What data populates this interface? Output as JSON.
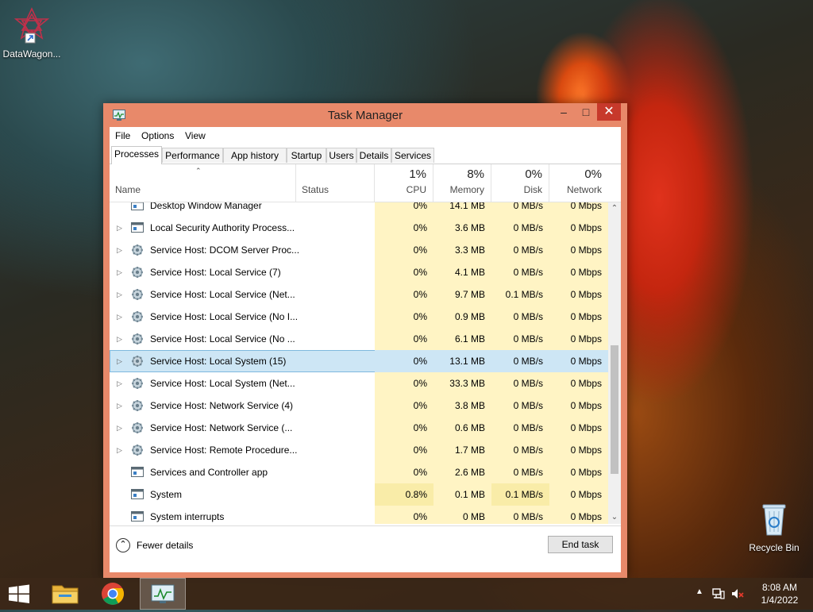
{
  "desktop": {
    "icons": [
      {
        "label": "DataWagon..."
      },
      {
        "label": "Recycle Bin"
      }
    ]
  },
  "window": {
    "title": "Task Manager",
    "controls": {
      "minimize": "‒",
      "maximize": "□",
      "close": "✕"
    }
  },
  "menu": [
    "File",
    "Options",
    "View"
  ],
  "tabs": [
    "Processes",
    "Performance",
    "App history",
    "Startup",
    "Users",
    "Details",
    "Services"
  ],
  "columns": {
    "name": "Name",
    "status": "Status",
    "cpu": {
      "pct": "1%",
      "label": "CPU"
    },
    "memory": {
      "pct": "8%",
      "label": "Memory"
    },
    "disk": {
      "pct": "0%",
      "label": "Disk"
    },
    "network": {
      "pct": "0%",
      "label": "Network"
    }
  },
  "processes": [
    {
      "name": "Desktop Window Manager",
      "expandable": false,
      "icon": "window-icon",
      "cpu": "0%",
      "memory": "14.1 MB",
      "disk": "0 MB/s",
      "network": "0 Mbps"
    },
    {
      "name": "Local Security Authority Process...",
      "expandable": true,
      "icon": "window-icon",
      "cpu": "0%",
      "memory": "3.6 MB",
      "disk": "0 MB/s",
      "network": "0 Mbps"
    },
    {
      "name": "Service Host: DCOM Server Proc...",
      "expandable": true,
      "icon": "gear-icon",
      "cpu": "0%",
      "memory": "3.3 MB",
      "disk": "0 MB/s",
      "network": "0 Mbps"
    },
    {
      "name": "Service Host: Local Service (7)",
      "expandable": true,
      "icon": "gear-icon",
      "cpu": "0%",
      "memory": "4.1 MB",
      "disk": "0 MB/s",
      "network": "0 Mbps"
    },
    {
      "name": "Service Host: Local Service (Net...",
      "expandable": true,
      "icon": "gear-icon",
      "cpu": "0%",
      "memory": "9.7 MB",
      "disk": "0.1 MB/s",
      "network": "0 Mbps"
    },
    {
      "name": "Service Host: Local Service (No I...",
      "expandable": true,
      "icon": "gear-icon",
      "cpu": "0%",
      "memory": "0.9 MB",
      "disk": "0 MB/s",
      "network": "0 Mbps"
    },
    {
      "name": "Service Host: Local Service (No ...",
      "expandable": true,
      "icon": "gear-icon",
      "cpu": "0%",
      "memory": "6.1 MB",
      "disk": "0 MB/s",
      "network": "0 Mbps"
    },
    {
      "name": "Service Host: Local System (15)",
      "expandable": true,
      "icon": "gear-icon",
      "cpu": "0%",
      "memory": "13.1 MB",
      "disk": "0 MB/s",
      "network": "0 Mbps",
      "selected": true
    },
    {
      "name": "Service Host: Local System (Net...",
      "expandable": true,
      "icon": "gear-icon",
      "cpu": "0%",
      "memory": "33.3 MB",
      "disk": "0 MB/s",
      "network": "0 Mbps"
    },
    {
      "name": "Service Host: Network Service (4)",
      "expandable": true,
      "icon": "gear-icon",
      "cpu": "0%",
      "memory": "3.8 MB",
      "disk": "0 MB/s",
      "network": "0 Mbps"
    },
    {
      "name": "Service Host: Network Service (...",
      "expandable": true,
      "icon": "gear-icon",
      "cpu": "0%",
      "memory": "0.6 MB",
      "disk": "0 MB/s",
      "network": "0 Mbps"
    },
    {
      "name": "Service Host: Remote Procedure...",
      "expandable": true,
      "icon": "gear-icon",
      "cpu": "0%",
      "memory": "1.7 MB",
      "disk": "0 MB/s",
      "network": "0 Mbps"
    },
    {
      "name": "Services and Controller app",
      "expandable": false,
      "icon": "window-icon",
      "cpu": "0%",
      "memory": "2.6 MB",
      "disk": "0 MB/s",
      "network": "0 Mbps"
    },
    {
      "name": "System",
      "expandable": false,
      "icon": "window-icon",
      "cpu": "0.8%",
      "memory": "0.1 MB",
      "disk": "0.1 MB/s",
      "network": "0 Mbps",
      "hot_cpu": true,
      "hot_disk": true
    },
    {
      "name": "System interrupts",
      "expandable": false,
      "icon": "window-icon",
      "cpu": "0%",
      "memory": "0 MB",
      "disk": "0 MB/s",
      "network": "0 Mbps"
    }
  ],
  "footer": {
    "fewer_details": "Fewer details",
    "end_task": "End task"
  },
  "taskbar": {
    "clock_time": "8:08 AM",
    "clock_date": "1/4/2022"
  },
  "colors": {
    "window_frame": "#e8896a",
    "close_button": "#c7392b",
    "heat": "#fff4c4",
    "selection": "#cde6f5"
  }
}
